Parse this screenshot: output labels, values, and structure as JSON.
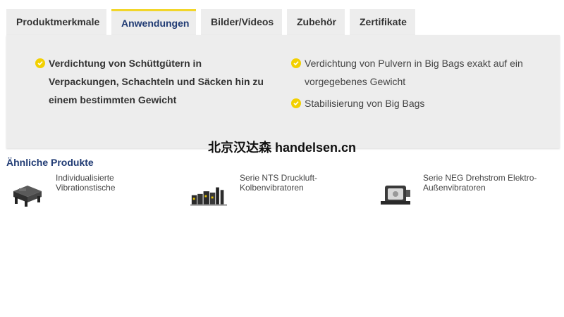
{
  "tabs": [
    {
      "label": "Produktmerkmale",
      "active": false
    },
    {
      "label": "Anwendungen",
      "active": true
    },
    {
      "label": "Bilder/Videos",
      "active": false
    },
    {
      "label": "Zubehör",
      "active": false
    },
    {
      "label": "Zertifikate",
      "active": false
    }
  ],
  "applications": {
    "left": [
      {
        "text": "Verdichtung von Schüttgütern in Verpackungen, Schachteln und Säcken hin zu einem bestimmten Gewicht"
      }
    ],
    "right": [
      {
        "text": "Verdichtung von Pulvern in Big Bags exakt auf ein vorgegebenes Gewicht"
      },
      {
        "text": "Stabilisierung von Big Bags"
      }
    ]
  },
  "watermark": "北京汉达森 handelsen.cn",
  "similar": {
    "title": "Ähnliche Produkte",
    "products": [
      {
        "name": "Individualisierte Vibrationstische"
      },
      {
        "name": "Serie NTS Druckluft-Kolbenvibratoren"
      },
      {
        "name": "Serie NEG Drehstrom Elektro-Außenvibratoren"
      }
    ]
  },
  "colors": {
    "accent": "#f2d62a",
    "heading": "#1f3a73",
    "panel": "#ededed"
  }
}
